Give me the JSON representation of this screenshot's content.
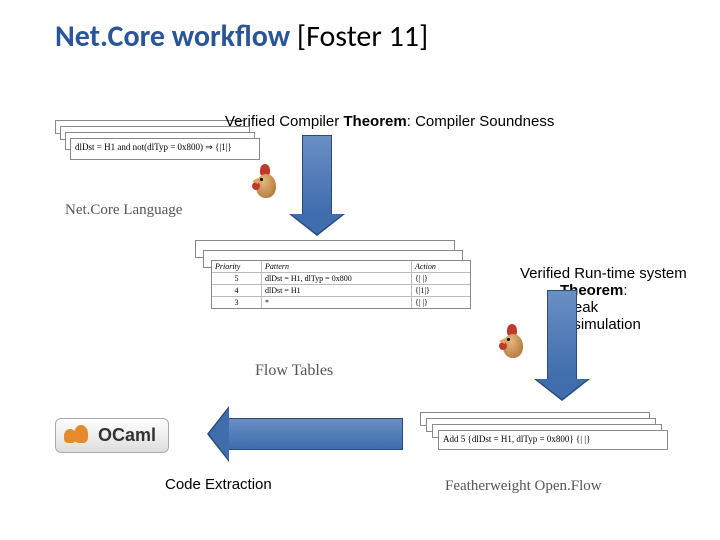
{
  "title": {
    "part1": "Net.Core workflow",
    "part2": " [Foster 11]"
  },
  "labels": {
    "compiler_prefix": "Verified Compiler ",
    "compiler_theorem": "Theorem",
    "compiler_suffix": ": Compiler Soundness",
    "runtime_line1": "Verified Run-time system",
    "runtime_line2_bold": "Theorem",
    "runtime_line2_suffix": ":",
    "runtime_line3": "Weak",
    "runtime_line4": "Bisimulation",
    "extraction": "Code Extraction",
    "netcore_lang": "Net.Core Language",
    "flow_tables": "Flow Tables",
    "featherweight": "Featherweight Open.Flow",
    "ocaml": "OCaml"
  },
  "netcore_snippet": "dlDst = H1 and not(dlTyp = 0x800) ⇒ {|1|}",
  "flow_table": {
    "headers": [
      "Priority",
      "Pattern",
      "Action"
    ],
    "rows": [
      [
        "5",
        "dlDst = H1, dlTyp = 0x800",
        "{| |}"
      ],
      [
        "4",
        "dlDst = H1",
        "{|1|}"
      ],
      [
        "3",
        "*",
        "{| |}"
      ]
    ]
  },
  "openflow_snippet": "Add 5 {dlDst = H1, dlTyp = 0x800} {| |}"
}
